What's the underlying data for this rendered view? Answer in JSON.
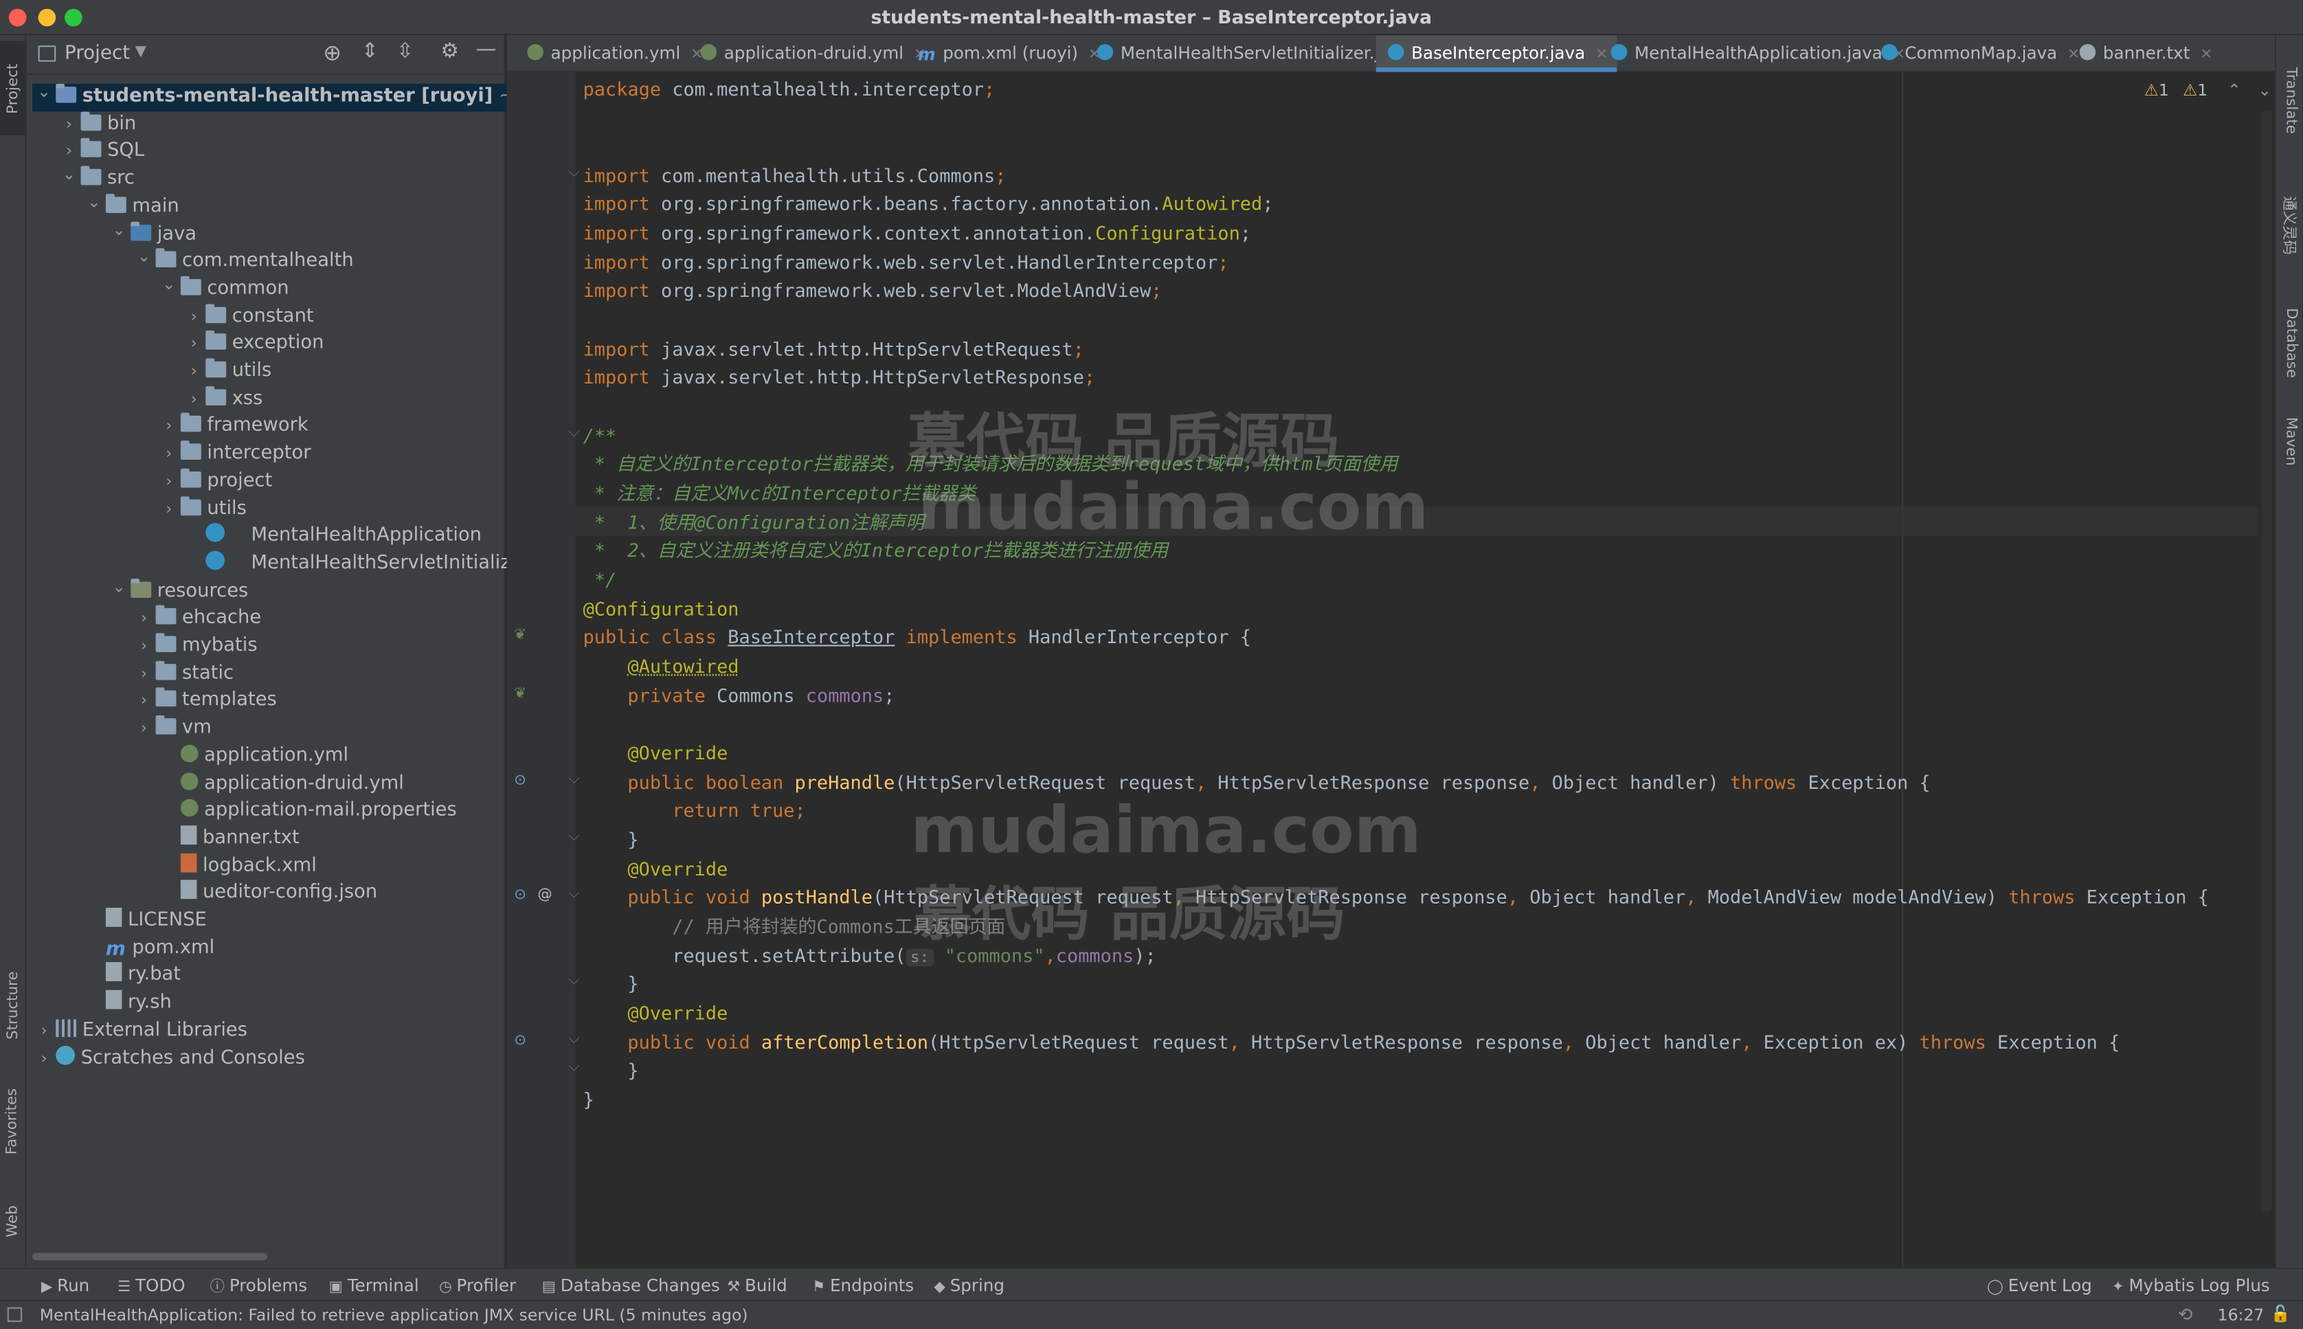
{
  "window": {
    "title": "students-mental-health-master – BaseInterceptor.java"
  },
  "left_stripe": {
    "project": "Project",
    "structure": "Structure",
    "favorites": "Favorites",
    "web": "Web"
  },
  "right_stripe": {
    "translate": "Translate",
    "tongyi": "通义灵码",
    "database": "Database",
    "maven": "Maven"
  },
  "project_panel": {
    "header": "Project"
  },
  "tree": [
    {
      "label": "students-mental-health-master",
      "extra": "[ruoyi]",
      "path": "~/Downlo",
      "icon": "module-folder-icon",
      "depth": 0,
      "state": "open"
    },
    {
      "label": "bin",
      "icon": "folder-icon",
      "depth": 1,
      "state": "closed"
    },
    {
      "label": "SQL",
      "icon": "folder-icon",
      "depth": 1,
      "state": "closed"
    },
    {
      "label": "src",
      "icon": "folder-icon",
      "depth": 1,
      "state": "open"
    },
    {
      "label": "main",
      "icon": "folder-icon",
      "depth": 2,
      "state": "open"
    },
    {
      "label": "java",
      "icon": "source-folder-icon",
      "depth": 3,
      "state": "open"
    },
    {
      "label": "com.mentalhealth",
      "icon": "package-icon",
      "depth": 4,
      "state": "open"
    },
    {
      "label": "common",
      "icon": "package-icon",
      "depth": 5,
      "state": "open"
    },
    {
      "label": "constant",
      "icon": "package-icon",
      "depth": 6,
      "state": "closed"
    },
    {
      "label": "exception",
      "icon": "package-icon",
      "depth": 6,
      "state": "closed"
    },
    {
      "label": "utils",
      "icon": "package-icon",
      "depth": 6,
      "state": "closed"
    },
    {
      "label": "xss",
      "icon": "package-icon",
      "depth": 6,
      "state": "closed"
    },
    {
      "label": "framework",
      "icon": "package-icon",
      "depth": 5,
      "state": "closed"
    },
    {
      "label": "interceptor",
      "icon": "package-icon",
      "depth": 5,
      "state": "closed"
    },
    {
      "label": "project",
      "icon": "package-icon",
      "depth": 5,
      "state": "closed"
    },
    {
      "label": "utils",
      "icon": "package-icon",
      "depth": 5,
      "state": "closed"
    },
    {
      "label": "MentalHealthApplication",
      "icon": "spring-class-icon",
      "depth": 6,
      "state": "leaf"
    },
    {
      "label": "MentalHealthServletInitializer",
      "icon": "spring-class-icon",
      "depth": 6,
      "state": "leaf"
    },
    {
      "label": "resources",
      "icon": "resources-folder-icon",
      "depth": 3,
      "state": "open"
    },
    {
      "label": "ehcache",
      "icon": "folder-icon",
      "depth": 4,
      "state": "closed"
    },
    {
      "label": "mybatis",
      "icon": "folder-icon",
      "depth": 4,
      "state": "closed"
    },
    {
      "label": "static",
      "icon": "folder-icon",
      "depth": 4,
      "state": "closed"
    },
    {
      "label": "templates",
      "icon": "folder-icon",
      "depth": 4,
      "state": "closed"
    },
    {
      "label": "vm",
      "icon": "folder-icon",
      "depth": 4,
      "state": "closed"
    },
    {
      "label": "application.yml",
      "icon": "yaml-file-icon",
      "depth": 5,
      "state": "leaf"
    },
    {
      "label": "application-druid.yml",
      "icon": "yaml-file-icon",
      "depth": 5,
      "state": "leaf"
    },
    {
      "label": "application-mail.properties",
      "icon": "properties-file-icon",
      "depth": 5,
      "state": "leaf"
    },
    {
      "label": "banner.txt",
      "icon": "text-file-icon",
      "depth": 5,
      "state": "leaf"
    },
    {
      "label": "logback.xml",
      "icon": "xml-file-icon",
      "depth": 5,
      "state": "leaf"
    },
    {
      "label": "ueditor-config.json",
      "icon": "json-file-icon",
      "depth": 5,
      "state": "leaf"
    },
    {
      "label": "LICENSE",
      "icon": "text-file-icon",
      "depth": 2,
      "state": "leaf"
    },
    {
      "label": "pom.xml",
      "icon": "maven-file-icon",
      "depth": 2,
      "state": "leaf"
    },
    {
      "label": "ry.bat",
      "icon": "script-file-icon",
      "depth": 2,
      "state": "leaf"
    },
    {
      "label": "ry.sh",
      "icon": "script-file-icon",
      "depth": 2,
      "state": "leaf"
    },
    {
      "label": "External Libraries",
      "icon": "libraries-icon",
      "depth": 0,
      "state": "closed"
    },
    {
      "label": "Scratches and Consoles",
      "icon": "scratches-icon",
      "depth": 0,
      "state": "closed"
    }
  ],
  "tabs": [
    {
      "label": "application.yml",
      "icon": "yaml-file-icon",
      "active": false
    },
    {
      "label": "application-druid.yml",
      "icon": "yaml-file-icon",
      "active": false
    },
    {
      "label": "pom.xml (ruoyi)",
      "icon": "maven-file-icon",
      "active": false
    },
    {
      "label": "MentalHealthServletInitializer.java",
      "icon": "class-icon",
      "active": false
    },
    {
      "label": "BaseInterceptor.java",
      "icon": "class-icon",
      "active": true
    },
    {
      "label": "MentalHealthApplication.java",
      "icon": "spring-class-icon",
      "active": false
    },
    {
      "label": "CommonMap.java",
      "icon": "class-icon",
      "active": false
    },
    {
      "label": "banner.txt",
      "icon": "text-file-icon",
      "active": false
    }
  ],
  "inspections": {
    "warnings_a": "1",
    "warnings_b": "1"
  },
  "code": {
    "l1": [
      "package com.mentalhealth.interceptor;"
    ],
    "l4": [
      "import com.mentalhealth.utils.Commons;"
    ],
    "l5": [
      "import org.springframework.beans.factory.annotation.",
      "Autowired",
      ";"
    ],
    "l6": [
      "import org.springframework.context.annotation.",
      "Configuration",
      ";"
    ],
    "l7": [
      "import org.springframework.web.servlet.HandlerInterceptor;"
    ],
    "l8": [
      "import org.springframework.web.servlet.ModelAndView;"
    ],
    "l10": [
      "import javax.servlet.http.HttpServletRequest;"
    ],
    "l11": [
      "import javax.servlet.http.HttpServletResponse;"
    ],
    "l13": [
      "/**"
    ],
    "l14": [
      " * 自定义的Interceptor拦截器类，用于封装请求后的数据类到request域中，供html页面使用"
    ],
    "l15": [
      " * 注意：自定义Mvc的Interceptor拦截器类"
    ],
    "l16": [
      " *  1、使用@Configuration注解声明"
    ],
    "l17": [
      " *  2、自定义注册类将自定义的Interceptor拦截器类进行注册使用"
    ],
    "l18": [
      " */"
    ],
    "l19": [
      "@Configuration"
    ],
    "l20": [
      "public class ",
      "BaseInterceptor",
      " implements ",
      "HandlerInterceptor {"
    ],
    "l21": [
      "    ",
      "@Autowired"
    ],
    "l22": [
      "    private ",
      "Commons ",
      "commons",
      ";"
    ],
    "l24": [
      "    @Override"
    ],
    "l25": [
      "    public boolean ",
      "preHandle",
      "(HttpServletRequest request",
      ", ",
      "HttpServletResponse response",
      ", ",
      "Object handler) ",
      "throws ",
      "Exception {"
    ],
    "l26": [
      "        return true;"
    ],
    "l27": [
      "    }"
    ],
    "l28": [
      "    @Override"
    ],
    "l29": [
      "    public void ",
      "postHandle",
      "(HttpServletRequest request",
      ", ",
      "HttpServletResponse response",
      ", ",
      "Object handler",
      ", ",
      "ModelAndView modelAndView) ",
      "throws ",
      "Exception {"
    ],
    "l30": [
      "        // 用户将封装的Commons工具返回页面"
    ],
    "l31": [
      "        request.setAttribute(",
      "s:",
      " \"commons\"",
      ",",
      "commons",
      ");"
    ],
    "l32": [
      "    }"
    ],
    "l33": [
      "    @Override"
    ],
    "l34": [
      "    public void ",
      "afterCompletion",
      "(HttpServletRequest request",
      ", ",
      "HttpServletResponse response",
      ", ",
      "Object handler",
      ", ",
      "Exception ex) ",
      "throws ",
      "Exception {"
    ],
    "l35": [
      "    }"
    ],
    "l36": [
      "}"
    ]
  },
  "watermarks": {
    "cn": "慕代码 品质源码",
    "en": "mudaima.com"
  },
  "tool_windows": [
    "Run",
    "TODO",
    "Problems",
    "Terminal",
    "Profiler",
    "Database Changes",
    "Build",
    "Endpoints",
    "Spring"
  ],
  "tool_windows_right": [
    "Event Log",
    "Mybatis Log Plus"
  ],
  "status": {
    "message": "MentalHealthApplication: Failed to retrieve application JMX service URL (5 minutes ago)",
    "time": "16:27"
  },
  "colors": {
    "keyword": "#cc7832",
    "annotation": "#bbb529",
    "doc_comment": "#629755",
    "field": "#9876aa",
    "method": "#ffc66d",
    "accent": "#4a88c7"
  }
}
